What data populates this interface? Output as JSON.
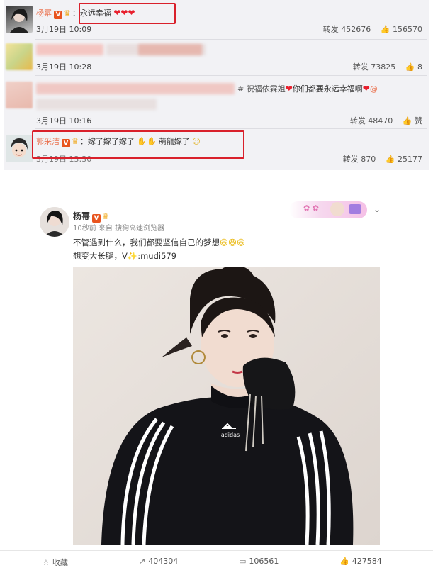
{
  "comments": [
    {
      "name": "杨幂",
      "badge": "V",
      "text": "：永远幸福",
      "hearts": "❤❤❤",
      "date": "3月19日 10:09",
      "repost_label": "转发",
      "repost_count": "452676",
      "like_count": "156570"
    },
    {
      "date": "3月19日 10:28",
      "repost_label": "转发",
      "repost_count": "73825",
      "like_count": "8"
    },
    {
      "text_a": "# 祝福依霖姐",
      "text_b": "你们都要永远幸福啊",
      "text_c": "@",
      "date": "3月19日 10:16",
      "repost_label": "转发",
      "repost_count": "48470",
      "like_label": "赞"
    },
    {
      "name": "郭采洁",
      "badge": "V",
      "text": "：嫁了嫁了嫁了",
      "text_b": "萌龍嫁了",
      "date": "3月19日 13:30",
      "repost_label": "转发",
      "repost_count": "870",
      "like_count": "25177"
    }
  ],
  "post": {
    "name": "杨幂",
    "badge": "V",
    "meta": "10秒前 来自 搜狗高速浏览器",
    "line1": "不管遇到什么，我们都要坚信自己的梦想",
    "line2_a": "想变大长腿，V",
    "line2_b": ":mudi579",
    "brand": "adidas",
    "actions": {
      "favorite_label": "收藏",
      "repost_count": "404304",
      "comment_count": "106561",
      "like_count": "427584"
    }
  },
  "colors": {
    "name": "#eb7350",
    "highlight_box": "#d9202b",
    "panel_bg": "#f2f2f5"
  }
}
